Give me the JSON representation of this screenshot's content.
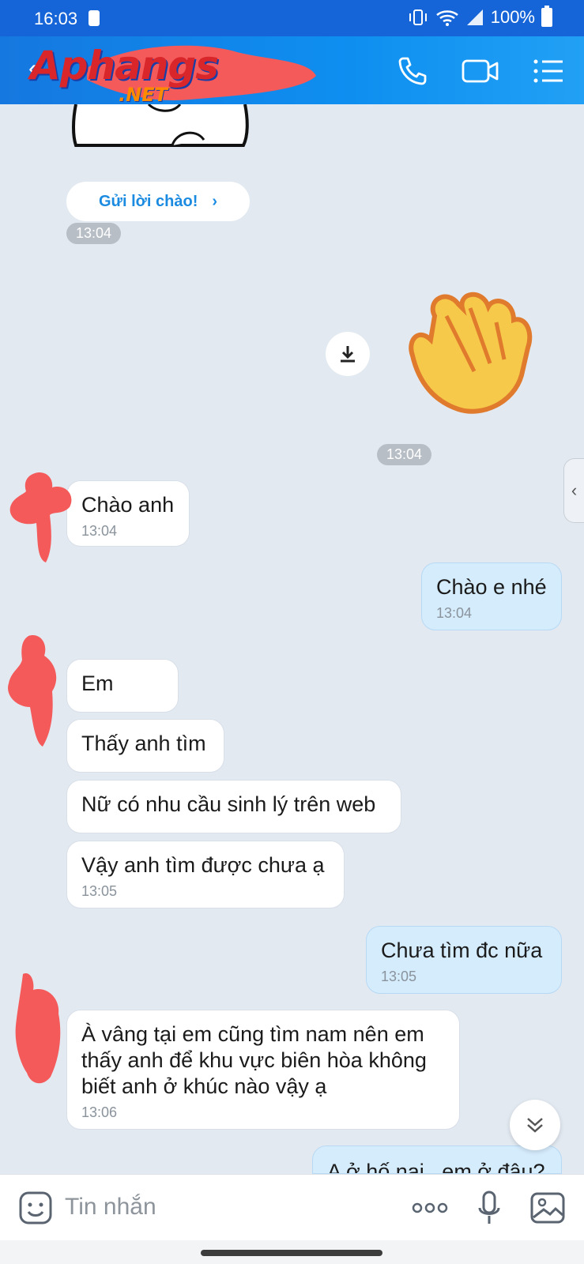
{
  "status_bar": {
    "time": "16:03",
    "battery": "100%"
  },
  "header": {
    "logo_text": "Aphangs",
    "logo_sub": ".NET",
    "icons": [
      "phone-icon",
      "video-call-icon",
      "menu-icon"
    ]
  },
  "greeting": {
    "label": "Gửi lời chào!",
    "time": "13:04"
  },
  "sticker_time": "13:04",
  "messages": [
    {
      "text": "Chào anh",
      "time": "13:04",
      "side": "left"
    },
    {
      "text": "Chào e nhé",
      "time": "13:04",
      "side": "right"
    },
    {
      "text": "Em",
      "side": "left"
    },
    {
      "text": "Thấy anh tìm",
      "side": "left"
    },
    {
      "text": "Nữ có nhu cầu sinh lý trên web",
      "side": "left"
    },
    {
      "text": "Vậy anh tìm được chưa ạ",
      "time": "13:05",
      "side": "left"
    },
    {
      "text": "Chưa tìm đc nữa",
      "time": "13:05",
      "side": "right"
    },
    {
      "text": "À vâng tại em cũng tìm nam nên em thấy anh để khu vực biên hòa không biết anh ở khúc nào vậy ạ",
      "time": "13:06",
      "side": "left"
    },
    {
      "text": "A ở hố nai , em ở đâu?",
      "side": "right"
    }
  ],
  "input": {
    "placeholder": "Tin nhắn"
  },
  "colors": {
    "header": "#1578e0",
    "background": "#e2e9f1",
    "my_bubble": "#d5ecfd",
    "scribble": "#f45a5a"
  }
}
